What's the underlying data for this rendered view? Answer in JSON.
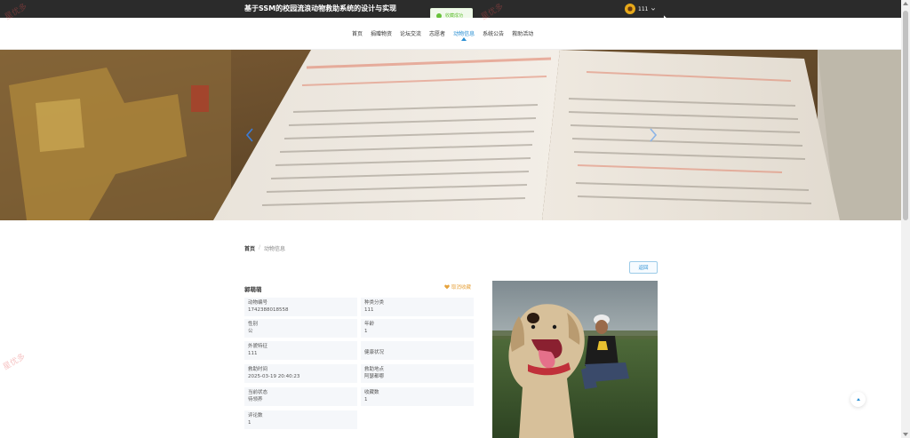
{
  "header": {
    "site_title": "基于SSM的校园流浪动物救助系统的设计与实现",
    "username": "111",
    "toast": "收藏成功"
  },
  "nav": {
    "items": [
      {
        "label": "首页"
      },
      {
        "label": "捐赠物资"
      },
      {
        "label": "论坛交流"
      },
      {
        "label": "志愿者"
      },
      {
        "label": "动物信息",
        "active": true
      },
      {
        "label": "系统公告"
      },
      {
        "label": "救助活动"
      }
    ]
  },
  "breadcrumb": {
    "home": "首页",
    "separator": "/",
    "current": "动物信息"
  },
  "detail": {
    "back_label": "返回",
    "name": "郭萌萌",
    "fav_label": "取消收藏",
    "fields": [
      {
        "label": "动物编号",
        "value": "1742388018558"
      },
      {
        "label": "种类分类",
        "value": "111"
      },
      {
        "label": "性别",
        "value": "公"
      },
      {
        "label": "年龄",
        "value": "1"
      },
      {
        "label": "外貌特征",
        "value": "111"
      },
      {
        "label": "健康状况",
        "value": ""
      },
      {
        "label": "救助时间",
        "value": "2025-03-19 20:40:23"
      },
      {
        "label": "救助地点",
        "value": "阿瑟都哪"
      },
      {
        "label": "当前状态",
        "value": "待领养"
      },
      {
        "label": "收藏数",
        "value": "1"
      },
      {
        "label": "评论数",
        "value": "1"
      }
    ]
  },
  "watermark": "星优多",
  "colors": {
    "accent": "#2a8fd3",
    "topbar": "#2b2b2b",
    "success": "#67c23a",
    "favorite": "#e6a23c",
    "field_bg": "#f5f7fa"
  }
}
